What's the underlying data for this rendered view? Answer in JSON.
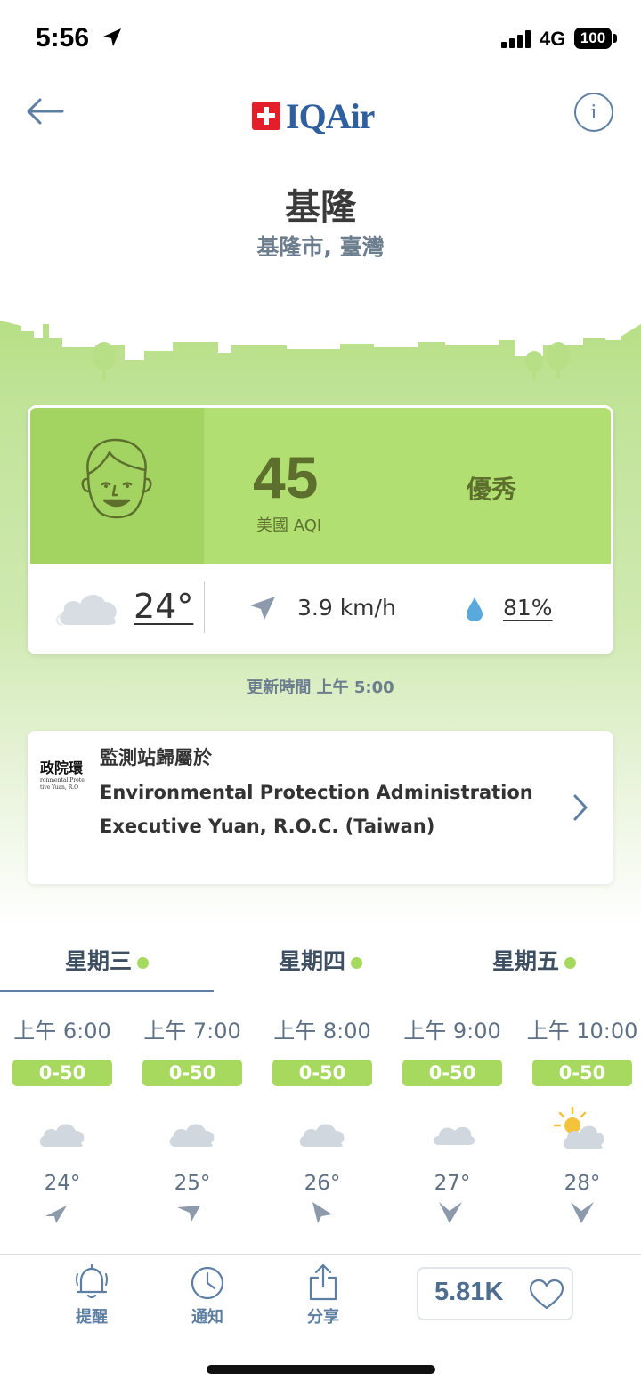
{
  "status_bar": {
    "time": "5:56",
    "network": "4G",
    "battery": "100"
  },
  "header": {
    "brand": "IQAir",
    "info_symbol": "i"
  },
  "location": {
    "city": "基隆",
    "region": "基隆市, 臺灣"
  },
  "aqi": {
    "value": "45",
    "label": "美國 AQI",
    "status": "優秀",
    "temperature": "24°",
    "wind": "3.9 km/h",
    "humidity": "81%"
  },
  "updated": "更新時間 上午 5:00",
  "station": {
    "title": "監測站歸屬於",
    "name": "Environmental Protection Administration Executive Yuan, R.O.C. (Taiwan)",
    "logo_text": "政院環",
    "logo_small_1": "ronmental Prote",
    "logo_small_2": "tive Yuan, R.O"
  },
  "tabs": [
    {
      "label": "星期三"
    },
    {
      "label": "星期四"
    },
    {
      "label": "星期五"
    }
  ],
  "hourly": [
    {
      "time": "上午 6:00",
      "range": "0-50",
      "temp": "24°",
      "weather": "cloudy-icon"
    },
    {
      "time": "上午 7:00",
      "range": "0-50",
      "temp": "25°",
      "weather": "cloudy-icon"
    },
    {
      "time": "上午 8:00",
      "range": "0-50",
      "temp": "26°",
      "weather": "cloudy-icon"
    },
    {
      "time": "上午 9:00",
      "range": "0-50",
      "temp": "27°",
      "weather": "cloud-icon"
    },
    {
      "time": "上午 10:00",
      "range": "0-50",
      "temp": "28°",
      "weather": "partly-sunny-icon"
    }
  ],
  "bottom_bar": {
    "alert": "提醒",
    "notify": "通知",
    "share": "分享",
    "likes": "5.81K"
  },
  "colors": {
    "aqi_green": "#b1df72",
    "face_green": "#a3d462",
    "badge_green": "#a6d95e",
    "text_blue": "#5d7fa3",
    "brand_red": "#e31f2a",
    "brand_blue": "#2f5f9e"
  }
}
